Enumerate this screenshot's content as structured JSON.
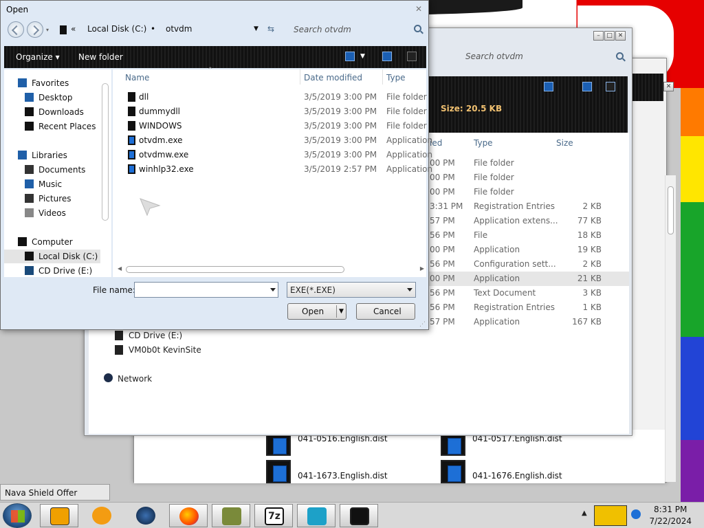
{
  "dialog": {
    "title": "Open",
    "address": {
      "root_chevron": "«",
      "drive": "Local Disk (C:)",
      "separator": "•",
      "folder": "otvdm"
    },
    "search_placeholder": "Search otvdm",
    "toolbar": {
      "organize": "Organize ▾",
      "new_folder": "New folder"
    },
    "columns": {
      "name": "Name",
      "date": "Date modified",
      "type": "Type"
    },
    "nav": [
      {
        "label": "Favorites",
        "icon": "star-icon"
      },
      {
        "label": "Desktop",
        "icon": "desktop-icon"
      },
      {
        "label": "Downloads",
        "icon": "downloads-icon"
      },
      {
        "label": "Recent Places",
        "icon": "recent-places-icon"
      },
      {
        "label": "Libraries",
        "icon": "libraries-icon"
      },
      {
        "label": "Documents",
        "icon": "documents-icon"
      },
      {
        "label": "Music",
        "icon": "music-icon"
      },
      {
        "label": "Pictures",
        "icon": "pictures-icon"
      },
      {
        "label": "Videos",
        "icon": "videos-icon"
      },
      {
        "label": "Computer",
        "icon": "computer-icon"
      },
      {
        "label": "Local Disk (C:)",
        "icon": "drive-icon"
      },
      {
        "label": "CD Drive (E:)",
        "icon": "cd-drive-icon"
      }
    ],
    "files": [
      {
        "name": "dll",
        "date": "3/5/2019 3:00 PM",
        "type": "File folder"
      },
      {
        "name": "dummydll",
        "date": "3/5/2019 3:00 PM",
        "type": "File folder"
      },
      {
        "name": "WINDOWS",
        "date": "3/5/2019 3:00 PM",
        "type": "File folder"
      },
      {
        "name": "otvdm.exe",
        "date": "3/5/2019 3:00 PM",
        "type": "Application"
      },
      {
        "name": "otvdmw.exe",
        "date": "3/5/2019 3:00 PM",
        "type": "Application"
      },
      {
        "name": "winhlp32.exe",
        "date": "3/5/2019 2:57 PM",
        "type": "Application"
      }
    ],
    "file_name_label": "File name:",
    "file_name_value": "",
    "filter": "EXE(*.EXE)",
    "open_button": "Open",
    "cancel_button": "Cancel"
  },
  "explorer2": {
    "search_placeholder": "Search otvdm",
    "size_text": "Size: 20.5 KB",
    "columns": {
      "modified_tail": "ied",
      "type": "Type",
      "size": "Size"
    },
    "rows": [
      {
        "time": "00 PM",
        "type": "File folder",
        "size": ""
      },
      {
        "time": "00 PM",
        "type": "File folder",
        "size": ""
      },
      {
        "time": "00 PM",
        "type": "File folder",
        "size": ""
      },
      {
        "time": "3:31 PM",
        "type": "Registration Entries",
        "size": "2 KB"
      },
      {
        "time": "57 PM",
        "type": "Application extens...",
        "size": "77 KB"
      },
      {
        "time": "56 PM",
        "type": "File",
        "size": "18 KB"
      },
      {
        "time": "00 PM",
        "type": "Application",
        "size": "19 KB"
      },
      {
        "time": "56 PM",
        "type": "Configuration sett...",
        "size": "2 KB"
      },
      {
        "time": "00 PM",
        "type": "Application",
        "size": "21 KB"
      },
      {
        "time": "56 PM",
        "type": "Text Document",
        "size": "3 KB"
      },
      {
        "time": "56 PM",
        "type": "Registration Entries",
        "size": "1 KB"
      },
      {
        "time": "57 PM",
        "type": "Application",
        "size": "167 KB"
      }
    ],
    "nav_bottom": [
      "CD Drive (E:)",
      "VM0b0t KevinSite",
      "Network"
    ]
  },
  "explorer3": {
    "items": [
      "041-0516.English.dist",
      "041-0517.English.dist",
      "041-1673.English.dist",
      "041-1676.English.dist"
    ]
  },
  "taskbar": {
    "tooltip": "Nava Shield Offer",
    "time": "8:31 PM",
    "date": "7/22/2024"
  }
}
